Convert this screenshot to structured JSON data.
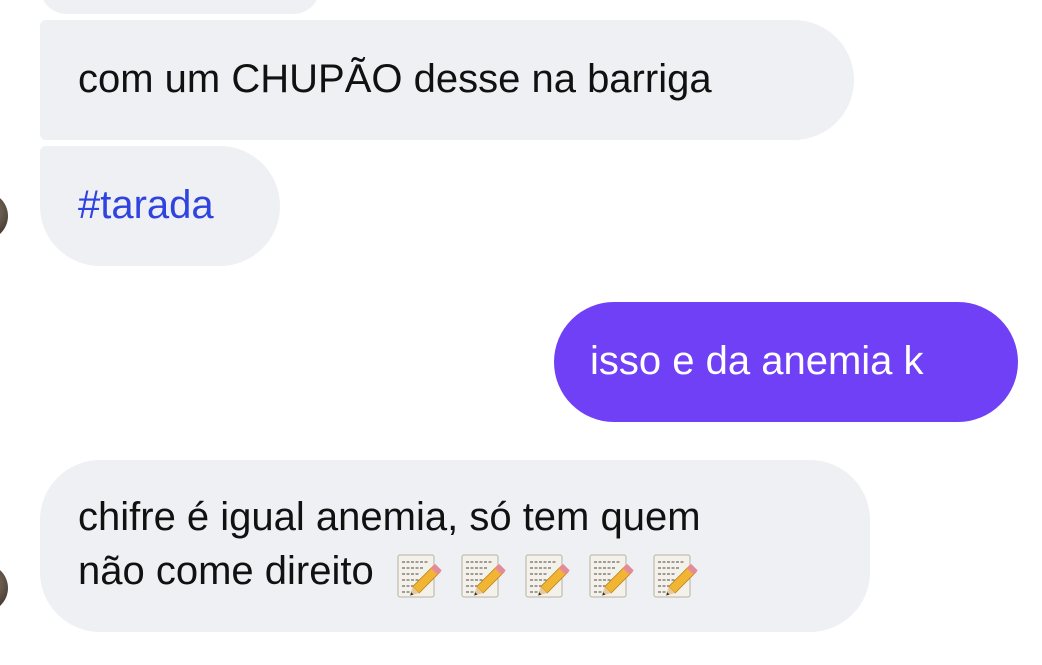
{
  "messages": [
    {
      "side": "received",
      "text": "com um CHUPÃO desse na barriga"
    },
    {
      "side": "received",
      "text": "#tarada"
    },
    {
      "side": "sent",
      "text": "isso e da anemia k"
    },
    {
      "side": "received",
      "line1": "chifre é igual anemia, só tem quem",
      "line2": "não come direito",
      "emoji": "memo-icon",
      "emoji_count": 5
    }
  ],
  "colors": {
    "received_bubble": "#eef0f3",
    "sent_bubble": "#7040f7",
    "hashtag": "#2f43e0",
    "text": "#111111"
  }
}
